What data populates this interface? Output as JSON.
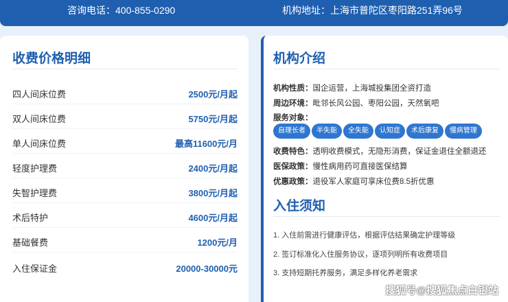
{
  "header": {
    "phone": "咨询电话：400-855-0290",
    "address": "机构地址：上海市普陀区枣阳路251弄96号"
  },
  "pricing": {
    "title": "收费价格明细",
    "items": [
      {
        "name": "四人间床位费",
        "value": "2500元/月起"
      },
      {
        "name": "双人间床位费",
        "value": "5750元/月起"
      },
      {
        "name": "单人间床位费",
        "value": "最高11600元/月"
      },
      {
        "name": "轻度护理费",
        "value": "2400元/月起"
      },
      {
        "name": "失智护理费",
        "value": "3800元/月起"
      },
      {
        "name": "术后特护",
        "value": "4600元/月起"
      },
      {
        "name": "基础餐费",
        "value": "1200元/月"
      },
      {
        "name": "入住保证金",
        "value": "20000-30000元"
      }
    ]
  },
  "intro": {
    "title": "机构介绍",
    "nature_label": "机构性质：",
    "nature": "国企运营，上海城投集团全资打造",
    "env_label": "周边环境：",
    "env": "毗邻长风公园、枣阳公园，天然氧吧",
    "service_label": "服务对象：",
    "tags": [
      "自理长者",
      "半失能",
      "全失能",
      "认知症",
      "术后康复",
      "慢病管理"
    ],
    "feature_label": "收费特色：",
    "feature": "透明收费模式，无隐形消费，保证金退住全额退还",
    "insurance_label": "医保政策：",
    "insurance": "慢性病用药可直接医保结算",
    "discount_label": "优惠政策：",
    "discount": "退役军人家庭可享床位费8.5折优惠"
  },
  "notice": {
    "title": "入住须知",
    "items": [
      "1. 入住前需进行健康评估，根据评估结果确定护理等级",
      "2. 签订标准化入住服务协议，逐项列明所有收费项目",
      "3. 支持短期托养服务，满足多样化养老需求"
    ]
  },
  "watermark": "搜狐号@搜狐焦点白银站"
}
